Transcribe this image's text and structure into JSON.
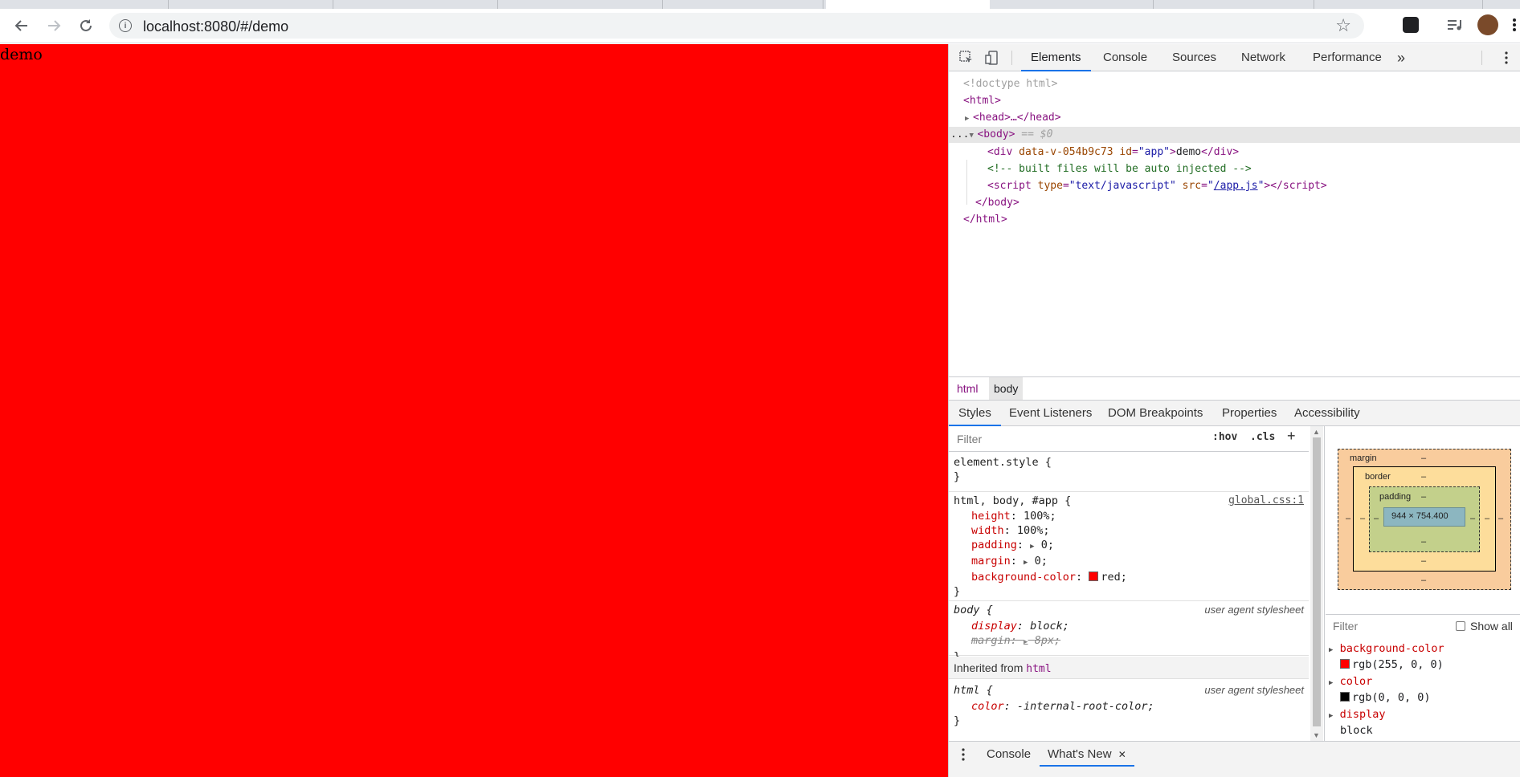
{
  "browser": {
    "url": "localhost:8080/#/demo",
    "back_icon": "arrow-back-icon",
    "forward_icon": "arrow-forward-icon",
    "reload_icon": "reload-icon"
  },
  "page": {
    "text": "demo",
    "background": "#ff0000"
  },
  "devtools": {
    "tabs": [
      "Elements",
      "Console",
      "Sources",
      "Network",
      "Performance"
    ],
    "more_tabs": "»",
    "dom": {
      "doctype": "<!doctype html>",
      "html_open": "<html>",
      "head": "<head>…</head>",
      "body_open": "<body>",
      "body_marker": "== $0",
      "div_tag": "div",
      "div_attr1": "data-v-054b9c73",
      "div_attr2_name": "id",
      "div_attr2_val": "\"app\"",
      "div_text": "demo",
      "comment": "<!-- built files will be auto injected -->",
      "script_tag": "script",
      "script_attr1_name": "type",
      "script_attr1_val": "\"text/javascript\"",
      "script_attr2_name": "src",
      "script_src": "/app.js",
      "body_close": "</body>",
      "html_close": "</html>",
      "ellipsis": "..."
    },
    "breadcrumb": [
      "html",
      "body"
    ],
    "subtabs": [
      "Styles",
      "Event Listeners",
      "DOM Breakpoints",
      "Properties",
      "Accessibility"
    ],
    "styles": {
      "filter_placeholder": "Filter",
      "hov": ":hov",
      "cls": ".cls",
      "add": "+",
      "element_style": "element.style {",
      "close_brace": "}",
      "rule1_selector": "html, body, #app {",
      "rule1_source": "global.css:1",
      "rule1_props": [
        {
          "name": "height",
          "value": "100%;"
        },
        {
          "name": "width",
          "value": "100%;"
        },
        {
          "name": "padding",
          "value": "0;"
        },
        {
          "name": "margin",
          "value": "0;"
        },
        {
          "name": "background-color",
          "value": "red;"
        }
      ],
      "rule2_selector": "body {",
      "rule2_source": "user agent stylesheet",
      "rule2_props": [
        {
          "name": "display",
          "value": "block;"
        },
        {
          "name": "margin",
          "value": "8px;"
        }
      ],
      "inherited_label": "Inherited from",
      "inherited_from": "html",
      "rule3_selector": "html {",
      "rule3_source": "user agent stylesheet",
      "rule3_props": [
        {
          "name": "color",
          "value": "-internal-root-color;"
        }
      ]
    },
    "boxmodel": {
      "margin_label": "margin",
      "border_label": "border",
      "padding_label": "padding",
      "dash": "–",
      "content_size": "944 × 754.400"
    },
    "computed": {
      "filter_placeholder": "Filter",
      "show_all": "Show all",
      "props": [
        {
          "name": "background-color",
          "value": "rgb(255, 0, 0)",
          "color": "#ff0000"
        },
        {
          "name": "color",
          "value": "rgb(0, 0, 0)",
          "color": "#000000"
        },
        {
          "name": "display",
          "value": "block"
        }
      ]
    },
    "drawer": {
      "tabs": [
        "Console",
        "What's New"
      ],
      "close": "✕"
    }
  }
}
